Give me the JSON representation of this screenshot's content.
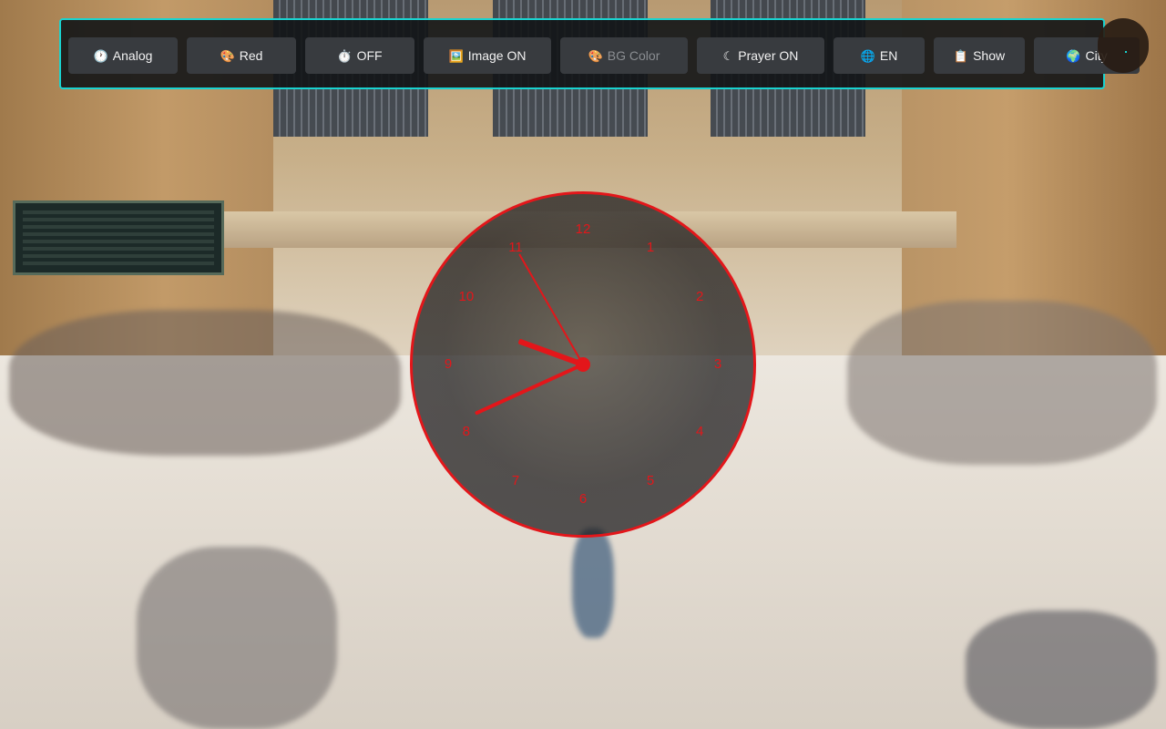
{
  "toolbar": {
    "buttons": [
      {
        "icon": "clock-icon",
        "glyph": "🕐",
        "label": "Analog",
        "enabled": true
      },
      {
        "icon": "palette-icon",
        "glyph": "🎨",
        "label": "Red",
        "enabled": true
      },
      {
        "icon": "timer-icon",
        "glyph": "⏱️",
        "label": "OFF",
        "enabled": true
      },
      {
        "icon": "image-icon",
        "glyph": "🖼️",
        "label": "Image ON",
        "enabled": true
      },
      {
        "icon": "palette-icon",
        "glyph": "🎨",
        "label": "BG Color",
        "enabled": false
      },
      {
        "icon": "moon-icon",
        "glyph": "☾",
        "label": "Prayer ON",
        "enabled": true
      },
      {
        "icon": "globe-icon",
        "glyph": "🌐",
        "label": "EN",
        "enabled": true
      },
      {
        "icon": "clipboard-icon",
        "glyph": "📋",
        "label": "Show",
        "enabled": true
      },
      {
        "icon": "world-icon",
        "glyph": "🌍",
        "label": "City",
        "enabled": true
      }
    ]
  },
  "clock": {
    "numbers": [
      "12",
      "1",
      "2",
      "3",
      "4",
      "5",
      "6",
      "7",
      "8",
      "9",
      "10",
      "11"
    ],
    "color": "#e3161a",
    "time": {
      "hour": 9,
      "minute": 40,
      "second": 55
    }
  },
  "colors": {
    "accent": "#19d3d0",
    "clock": "#e3161a"
  }
}
